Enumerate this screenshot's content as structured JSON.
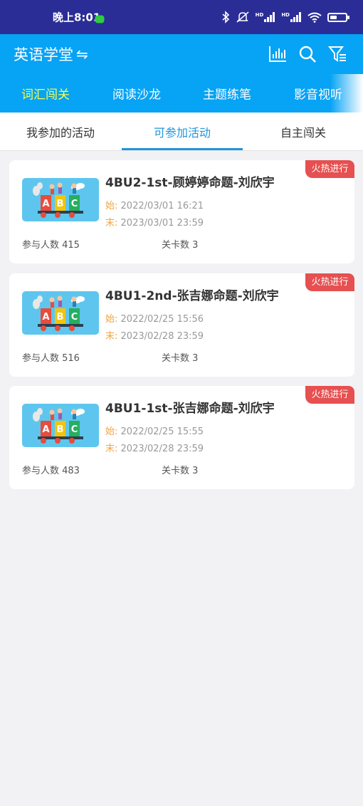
{
  "status_bar": {
    "time": "晚上8:01",
    "hd1": "HD",
    "hd2": "HD",
    "battery_level": 0.45
  },
  "header": {
    "title": "英语学堂",
    "switch_glyph": "⇋",
    "icons": [
      "bar-chart-icon",
      "search-icon",
      "filter-icon"
    ]
  },
  "category_tabs": [
    {
      "label": "词汇闯关",
      "active": true
    },
    {
      "label": "阅读沙龙",
      "active": false
    },
    {
      "label": "主题练笔",
      "active": false
    },
    {
      "label": "影音视听",
      "active": false
    }
  ],
  "sub_tabs": [
    {
      "label": "我参加的活动",
      "active": false
    },
    {
      "label": "可参加活动",
      "active": true
    },
    {
      "label": "自主闯关",
      "active": false
    }
  ],
  "cards": [
    {
      "title": "4BU2-1st-顾婷婷命题-刘欣宇",
      "start_label": "始:",
      "start": "2022/03/01 16:21",
      "end_label": "末:",
      "end": "2023/03/01 23:59",
      "participants": "参与人数 415",
      "levels": "关卡数 3",
      "badge": "火热进行"
    },
    {
      "title": "4BU1-2nd-张吉娜命题-刘欣宇",
      "start_label": "始:",
      "start": "2022/02/25 15:56",
      "end_label": "末:",
      "end": "2023/02/28 23:59",
      "participants": "参与人数 516",
      "levels": "关卡数 3",
      "badge": "火热进行"
    },
    {
      "title": "4BU1-1st-张吉娜命题-刘欣宇",
      "start_label": "始:",
      "start": "2022/02/25 15:55",
      "end_label": "末:",
      "end": "2023/02/28 23:59",
      "participants": "参与人数 483",
      "levels": "关卡数 3",
      "badge": "火热进行"
    }
  ],
  "colors": {
    "status_bar": "#2b2d97",
    "header": "#07a3f5",
    "active_category": "#f5ff4f",
    "active_subtab": "#1f96d9",
    "badge": "#e65050",
    "date_label": "#f3a33b"
  }
}
